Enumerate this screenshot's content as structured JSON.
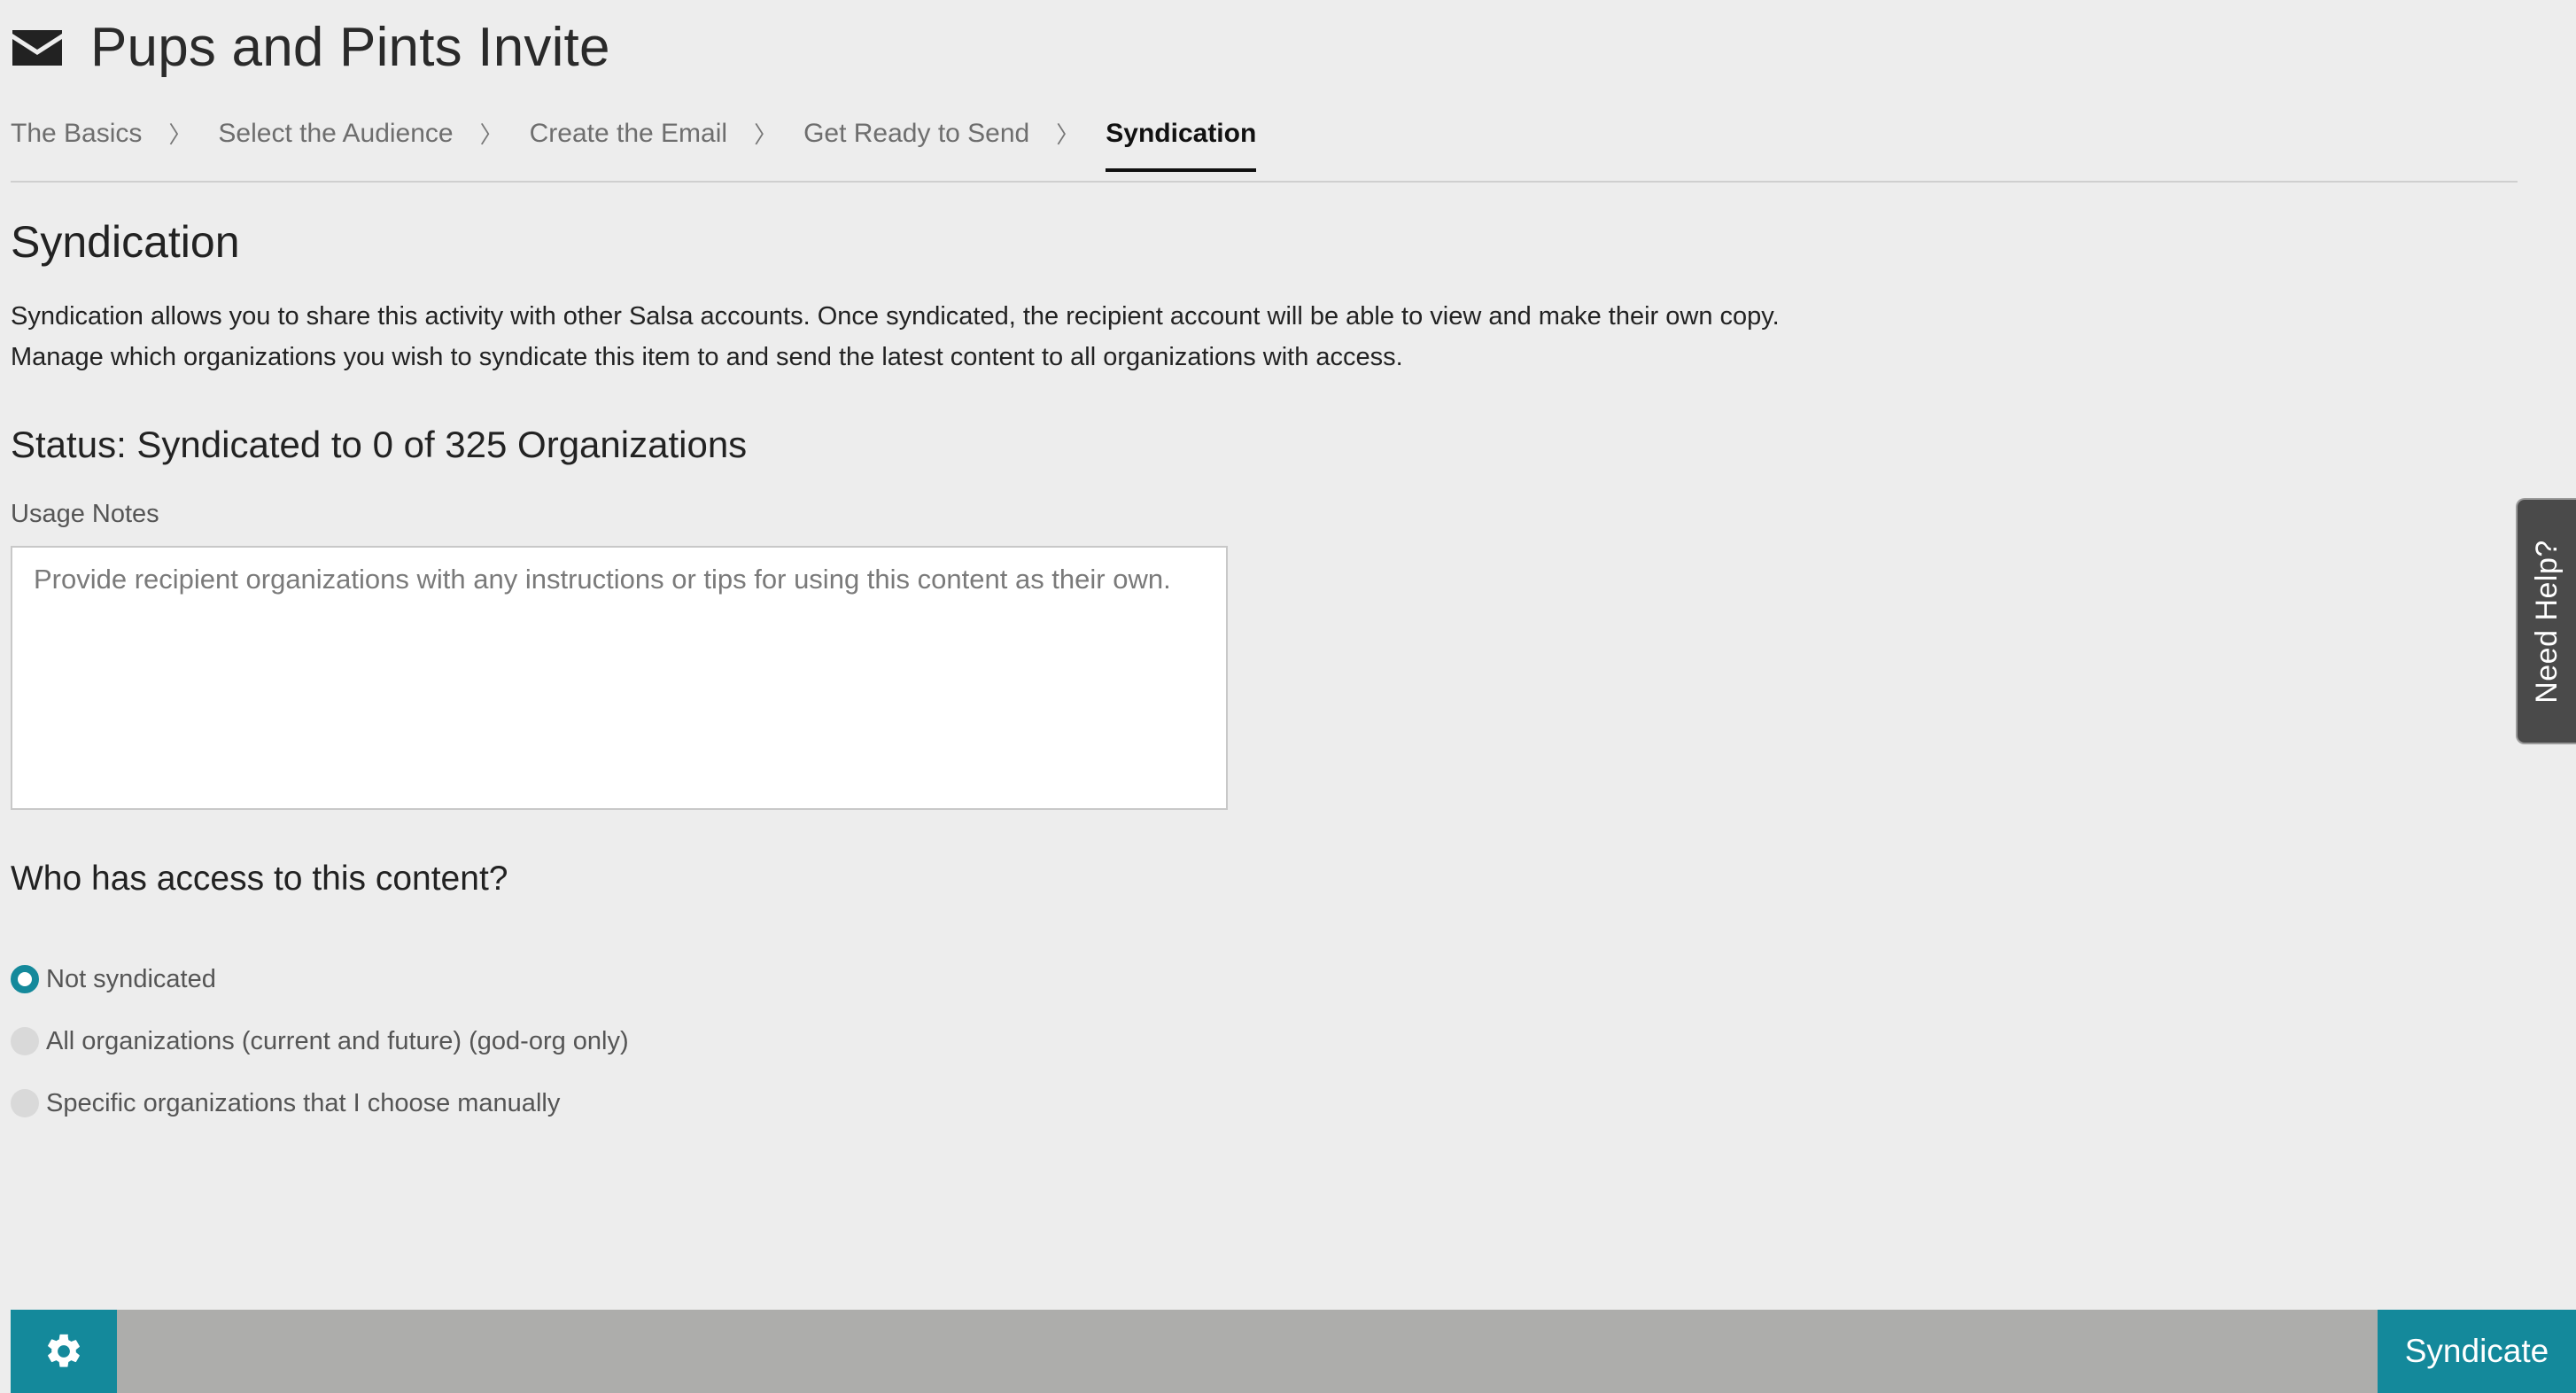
{
  "header": {
    "title": "Pups and Pints Invite",
    "icon": "envelope-icon"
  },
  "steps": [
    {
      "label": "The Basics",
      "active": false
    },
    {
      "label": "Select the Audience",
      "active": false
    },
    {
      "label": "Create the Email",
      "active": false
    },
    {
      "label": "Get Ready to Send",
      "active": false
    },
    {
      "label": "Syndication",
      "active": true
    }
  ],
  "step_separator": "〉",
  "main": {
    "section_title": "Syndication",
    "description_line1": "Syndication allows you to share this activity with other Salsa accounts. Once syndicated, the recipient account will be able to view and make their own copy.",
    "description_line2": "Manage which organizations you wish to syndicate this item to and send the latest content to all organizations with access.",
    "status": "Status: Syndicated to 0 of 325 Organizations",
    "usage_notes": {
      "label": "Usage Notes",
      "value": "",
      "placeholder": "Provide recipient organizations with any instructions or tips for using this content as their own."
    },
    "access_title": "Who has access to this content?",
    "access_options": [
      {
        "label": "Not syndicated",
        "checked": true
      },
      {
        "label": "All organizations (current and future) (god-org only)",
        "checked": false
      },
      {
        "label": "Specific organizations that I choose manually",
        "checked": false
      }
    ]
  },
  "need_help": {
    "label": "Need Help?"
  },
  "footer": {
    "settings_icon": "gear-icon",
    "syndicate_label": "Syndicate"
  },
  "colors": {
    "accent": "#14899b",
    "background": "#ededed",
    "footer_bar": "#adadab",
    "help_tab": "#4a4a4a"
  }
}
